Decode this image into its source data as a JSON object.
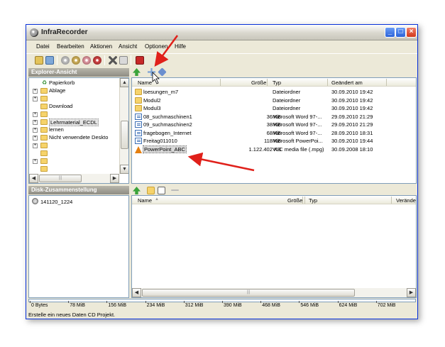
{
  "window": {
    "title": "InfraRecorder",
    "buttons": {
      "minimize": "_",
      "maximize": "□",
      "close": "×"
    }
  },
  "menu": [
    "Datei",
    "Bearbeiten",
    "Aktionen",
    "Ansicht",
    "Optionen",
    "Hilfe"
  ],
  "explorer": {
    "header": "Explorer-Ansicht",
    "tree": [
      {
        "label": "Papierkorb",
        "type": "recycle"
      },
      {
        "label": "Ablage",
        "type": "folder",
        "expand": true
      },
      {
        "label": "",
        "type": "folder",
        "expand": true
      },
      {
        "label": "Download",
        "type": "folder",
        "expand": false
      },
      {
        "label": "",
        "type": "folder",
        "expand": true
      },
      {
        "label": "Lehrmaterial_ECDL",
        "type": "folder",
        "expand": true,
        "selected": true
      },
      {
        "label": "lernen",
        "type": "folder",
        "expand": true
      },
      {
        "label": "Nicht verwendete Deskto",
        "type": "folder",
        "expand": true
      },
      {
        "label": "",
        "type": "folder",
        "expand": true
      },
      {
        "label": "",
        "type": "folder",
        "expand": false
      },
      {
        "label": "",
        "type": "folder",
        "expand": true
      },
      {
        "label": "",
        "type": "folder",
        "expand": false
      }
    ],
    "columns": [
      "Name",
      "Größe",
      "Typ",
      "Geändert am"
    ],
    "files": [
      {
        "name": "loesungen_m7",
        "size": "",
        "type": "Dateiordner",
        "date": "30.09.2010 19:42",
        "icon": "folder"
      },
      {
        "name": "Modul2",
        "size": "",
        "type": "Dateiordner",
        "date": "30.09.2010 19:42",
        "icon": "folder"
      },
      {
        "name": "Modul3",
        "size": "",
        "type": "Dateiordner",
        "date": "30.09.2010 19:42",
        "icon": "folder"
      },
      {
        "name": "08_suchmaschinen1",
        "size": "36 KB",
        "type": "Microsoft Word 97-...",
        "date": "29.09.2010 21:29",
        "icon": "doc"
      },
      {
        "name": "09_suchmaschinen2",
        "size": "38 KB",
        "type": "Microsoft Word 97-...",
        "date": "29.09.2010 21:29",
        "icon": "doc"
      },
      {
        "name": "fragebogen_Internet",
        "size": "68 KB",
        "type": "Microsoft Word 97-...",
        "date": "28.09.2010 18:31",
        "icon": "doc"
      },
      {
        "name": "Freitag011010",
        "size": "118 KB",
        "type": "Microsoft PowerPoi...",
        "date": "30.09.2010 19:44",
        "icon": "doc"
      },
      {
        "name": "PowerPoint_ABC",
        "size": "1.122.402 KB",
        "type": "VLC media file (.mpg)",
        "date": "30.09.2008 18:10",
        "icon": "vlc",
        "selected": true
      }
    ]
  },
  "disc": {
    "header": "Disk-Zusammenstellung",
    "item": "141120_1224",
    "columns": [
      "Name",
      "Größe",
      "Typ",
      "Verände"
    ],
    "sort_arrow": "▲"
  },
  "sizebar": [
    "0 Bytes",
    "78 MiB",
    "156 MiB",
    "234 MiB",
    "312 MiB",
    "390 MiB",
    "468 MiB",
    "546 MiB",
    "624 MiB",
    "702 MiB"
  ],
  "status": "Erstelle ein neues Daten CD Projekt.",
  "scroll": {
    "up": "▲",
    "down": "▼",
    "left": "◀",
    "right": "▶",
    "grip": "|||"
  },
  "tree_expander": "+",
  "colors": {
    "annotation_arrow": "#e0201a",
    "titlebar_accent": "#0831d9"
  }
}
